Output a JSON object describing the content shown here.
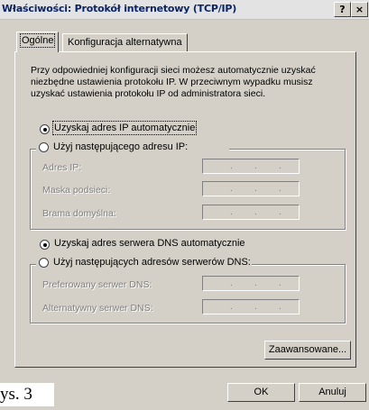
{
  "window": {
    "title": "Właściwości: Protokół internetowy (TCP/IP)",
    "help_glyph": "?",
    "close_glyph": "×"
  },
  "tabs": [
    {
      "label": "Ogólne",
      "active": true
    },
    {
      "label": "Konfiguracja alternatywna",
      "active": false
    }
  ],
  "intro_text": "Przy odpowiedniej konfiguracji sieci możesz automatycznie uzyskać niezbędne ustawienia protokołu IP. W przeciwnym wypadku musisz uzyskać ustawienia protokołu IP od administratora sieci.",
  "ip_section": {
    "auto_label": "Uzyskaj adres IP automatycznie",
    "manual_label": "Użyj następującego adresu IP:",
    "selected": "auto",
    "fields": [
      {
        "label": "Adres IP:",
        "value": ""
      },
      {
        "label": "Maska podsieci:",
        "value": ""
      },
      {
        "label": "Brama domyślna:",
        "value": ""
      }
    ]
  },
  "dns_section": {
    "auto_label": "Uzyskaj adres serwera DNS automatycznie",
    "manual_label": "Użyj następujących adresów serwerów DNS:",
    "selected": "auto",
    "fields": [
      {
        "label": "Preferowany serwer DNS:",
        "value": ""
      },
      {
        "label": "Alternatywny serwer DNS:",
        "value": ""
      }
    ]
  },
  "buttons": {
    "advanced": "Zaawansowane...",
    "ok": "OK",
    "cancel": "Anuluj"
  },
  "caption": "ys. 3",
  "ip_dot": "."
}
